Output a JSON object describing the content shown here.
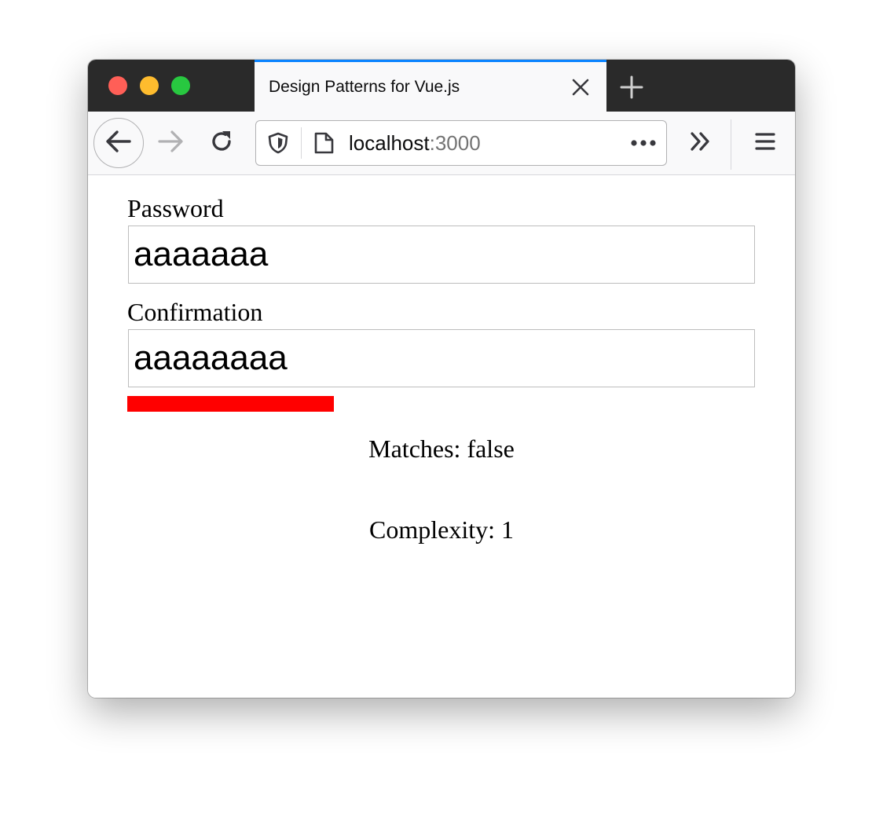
{
  "browser": {
    "tab_title": "Design Patterns for Vue.js",
    "url_host": "localhost",
    "url_port": ":3000",
    "traffic_colors": {
      "close": "#ff5f57",
      "minimize": "#febc2e",
      "maximize": "#28c840"
    },
    "accent_color": "#0a84ff"
  },
  "form": {
    "password_label": "Password",
    "password_value": "aaaaaaa",
    "confirmation_label": "Confirmation",
    "confirmation_value": "aaaaaaaa",
    "strength_color": "#ff0000",
    "strength_level": 0.33
  },
  "status": {
    "matches_text": "Matches: false",
    "complexity_text": "Complexity: 1"
  },
  "icons": [
    "back-arrow-icon",
    "forward-arrow-icon",
    "reload-icon",
    "shield-icon",
    "page-icon",
    "more-icon",
    "overflow-chevron-icon",
    "hamburger-menu-icon",
    "close-icon",
    "plus-icon"
  ]
}
